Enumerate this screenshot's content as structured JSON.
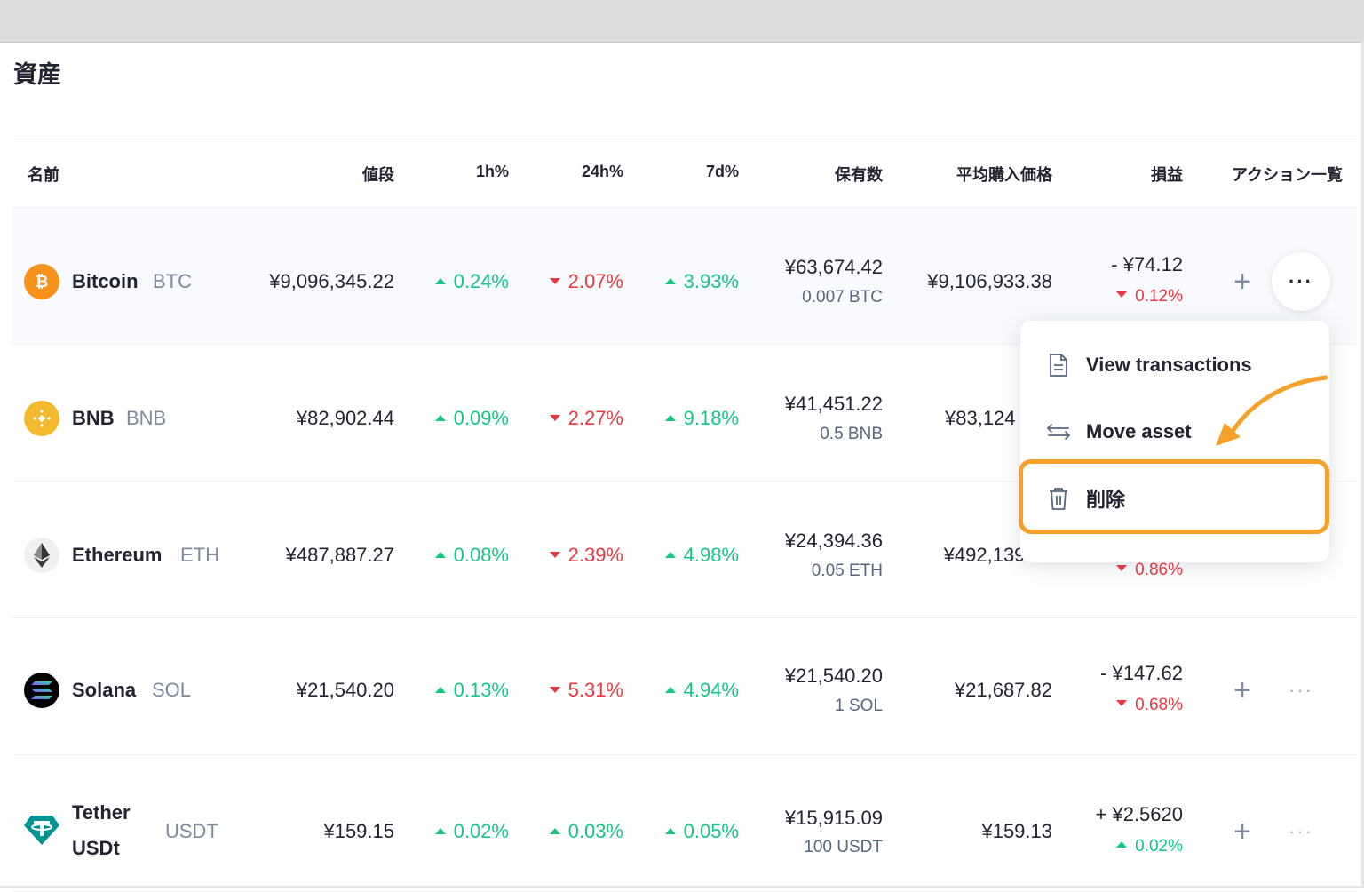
{
  "page": {
    "title": "資産"
  },
  "columns": {
    "name": "名前",
    "price": "値段",
    "h1": "1h%",
    "h24": "24h%",
    "d7": "7d%",
    "holdings": "保有数",
    "avg_buy": "平均購入価格",
    "pnl": "損益",
    "actions": "アクション一覧"
  },
  "rows": [
    {
      "name": "Bitcoin",
      "symbol": "BTC",
      "price": "¥9,096,345.22",
      "h1": "0.24%",
      "h1_dir": "up",
      "h24": "2.07%",
      "h24_dir": "down",
      "d7": "3.93%",
      "d7_dir": "up",
      "holdings_value": "¥63,674.42",
      "holdings_amount": "0.007 BTC",
      "avg_buy": "¥9,106,933.38",
      "pnl_value": "- ¥74.12",
      "pnl_pct": "0.12%",
      "pnl_dir": "down",
      "icon": "bitcoin-icon",
      "icon_color": "#f7931a"
    },
    {
      "name": "BNB",
      "symbol": "BNB",
      "price": "¥82,902.44",
      "h1": "0.09%",
      "h1_dir": "up",
      "h24": "2.27%",
      "h24_dir": "down",
      "d7": "9.18%",
      "d7_dir": "up",
      "holdings_value": "¥41,451.22",
      "holdings_amount": "0.5 BNB",
      "avg_buy": "¥83,124",
      "icon": "bnb-icon",
      "icon_color": "#f3ba2f"
    },
    {
      "name": "Ethereum",
      "symbol": "ETH",
      "price": "¥487,887.27",
      "h1": "0.08%",
      "h1_dir": "up",
      "h24": "2.39%",
      "h24_dir": "down",
      "d7": "4.98%",
      "d7_dir": "up",
      "holdings_value": "¥24,394.36",
      "holdings_amount": "0.05 ETH",
      "avg_buy": "¥492,139.35",
      "pnl_pct": "0.86%",
      "pnl_dir": "down",
      "icon": "ethereum-icon",
      "icon_color": "#f0f0f0"
    },
    {
      "name": "Solana",
      "symbol": "SOL",
      "price": "¥21,540.20",
      "h1": "0.13%",
      "h1_dir": "up",
      "h24": "5.31%",
      "h24_dir": "down",
      "d7": "4.94%",
      "d7_dir": "up",
      "holdings_value": "¥21,540.20",
      "holdings_amount": "1 SOL",
      "avg_buy": "¥21,687.82",
      "pnl_value": "- ¥147.62",
      "pnl_pct": "0.68%",
      "pnl_dir": "down",
      "icon": "solana-icon",
      "icon_color": "#000000"
    },
    {
      "name_line1": "Tether",
      "name_line2": "USDt",
      "symbol": "USDT",
      "price": "¥159.15",
      "h1": "0.02%",
      "h1_dir": "up",
      "h24": "0.03%",
      "h24_dir": "up",
      "d7": "0.05%",
      "d7_dir": "up",
      "holdings_value": "¥15,915.09",
      "holdings_amount": "100 USDT",
      "avg_buy": "¥159.13",
      "pnl_value": "+ ¥2.5620",
      "pnl_pct": "0.02%",
      "pnl_dir": "up",
      "icon": "tether-icon",
      "icon_color": "#009393"
    }
  ],
  "actions": {
    "add_label": "+",
    "more_label": "···"
  },
  "menu": {
    "items": [
      {
        "label": "View transactions",
        "icon": "document-icon"
      },
      {
        "label": "Move asset",
        "icon": "swap-arrows-icon"
      },
      {
        "label": "削除",
        "icon": "trash-icon"
      }
    ]
  },
  "colors": {
    "up": "#16c784",
    "down": "#ea3943",
    "highlight": "#f5a12b"
  }
}
